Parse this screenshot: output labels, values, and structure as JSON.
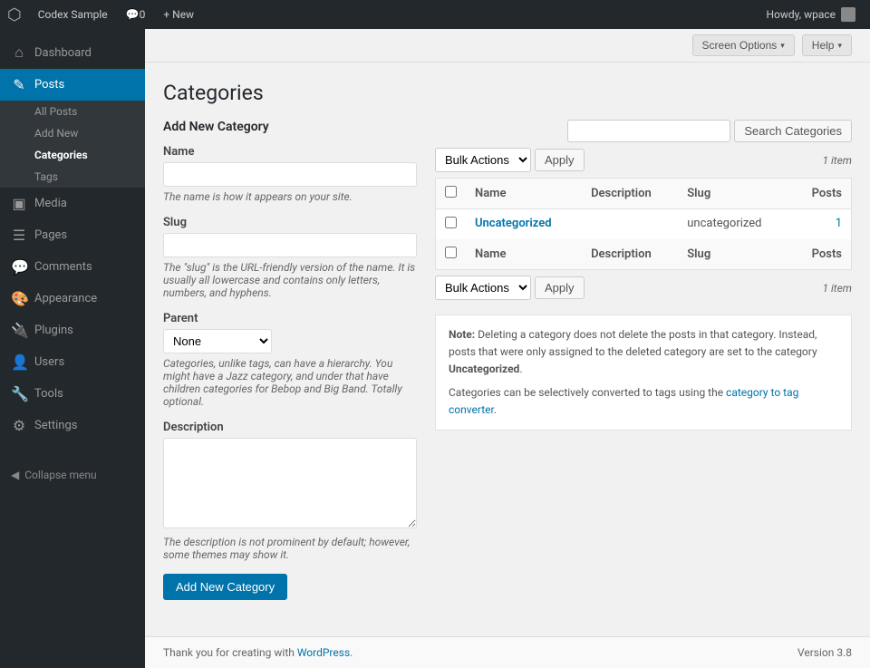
{
  "adminbar": {
    "logo": "⚙",
    "site_name": "Codex Sample",
    "comments_label": "Comments",
    "comments_count": "0",
    "new_label": "+ New",
    "howdy": "Howdy, wpace",
    "screen_options_label": "Screen Options",
    "help_label": "Help"
  },
  "sidebar": {
    "items": [
      {
        "id": "dashboard",
        "label": "Dashboard",
        "icon": "⌂",
        "active": false
      },
      {
        "id": "posts",
        "label": "Posts",
        "icon": "✎",
        "active": true
      },
      {
        "id": "media",
        "label": "Media",
        "icon": "▣",
        "active": false
      },
      {
        "id": "pages",
        "label": "Pages",
        "icon": "☰",
        "active": false
      },
      {
        "id": "comments",
        "label": "Comments",
        "icon": "💬",
        "active": false
      },
      {
        "id": "appearance",
        "label": "Appearance",
        "icon": "🎨",
        "active": false
      },
      {
        "id": "plugins",
        "label": "Plugins",
        "icon": "🔌",
        "active": false
      },
      {
        "id": "users",
        "label": "Users",
        "icon": "👤",
        "active": false
      },
      {
        "id": "tools",
        "label": "Tools",
        "icon": "🔧",
        "active": false
      },
      {
        "id": "settings",
        "label": "Settings",
        "icon": "⚙",
        "active": false
      }
    ],
    "posts_submenu": [
      {
        "id": "all-posts",
        "label": "All Posts",
        "active": false
      },
      {
        "id": "add-new",
        "label": "Add New",
        "active": false
      },
      {
        "id": "categories",
        "label": "Categories",
        "active": true
      },
      {
        "id": "tags",
        "label": "Tags",
        "active": false
      }
    ],
    "collapse_label": "Collapse menu"
  },
  "page": {
    "title": "Categories",
    "add_new_heading": "Add New Category",
    "name_label": "Name",
    "name_note": "The name is how it appears on your site.",
    "slug_label": "Slug",
    "slug_note": "The \"slug\" is the URL-friendly version of the name. It is usually all lowercase and contains only letters, numbers, and hyphens.",
    "parent_label": "Parent",
    "parent_option": "None",
    "parent_note": "Categories, unlike tags, can have a hierarchy. You might have a Jazz category, and under that have children categories for Bebop and Big Band. Totally optional.",
    "description_label": "Description",
    "description_note": "The description is not prominent by default; however, some themes may show it.",
    "add_button_label": "Add New Category"
  },
  "table": {
    "bulk_actions_label": "Bulk Actions",
    "apply_top_label": "Apply",
    "apply_bottom_label": "Apply",
    "search_placeholder": "",
    "search_button_label": "Search Categories",
    "item_count_top": "1 item",
    "item_count_bottom": "1 item",
    "columns": {
      "name": "Name",
      "description": "Description",
      "slug": "Slug",
      "posts": "Posts"
    },
    "rows": [
      {
        "name": "Uncategorized",
        "description": "",
        "slug": "uncategorized",
        "posts": "1",
        "link": true
      }
    ]
  },
  "notes": {
    "label": "Note:",
    "text1": "Deleting a category does not delete the posts in that category. Instead, posts that were only assigned to the deleted category are set to the category ",
    "uncategorized": "Uncategorized",
    "text2": ".",
    "text3": "Categories can be selectively converted to tags using the ",
    "converter_link_text": "category to tag converter",
    "text4": "."
  },
  "footer": {
    "thank_you_text": "Thank you for creating with ",
    "wordpress_link": "WordPress",
    "version": "Version 3.8"
  }
}
